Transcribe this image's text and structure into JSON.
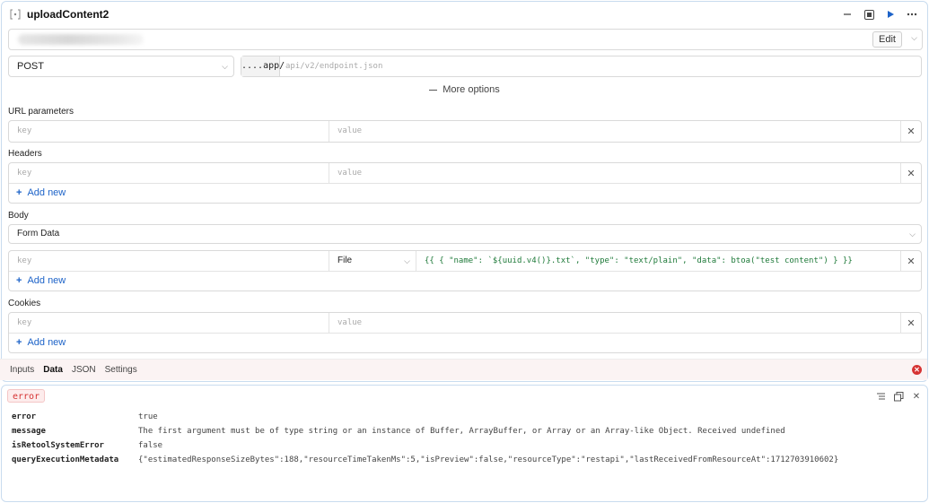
{
  "query": {
    "title": "uploadContent2",
    "edit_label": "Edit",
    "method": "POST",
    "url_prefix": "....app/",
    "url_placeholder": "api/v2/endpoint.json",
    "more_options": "More options"
  },
  "url_params": {
    "label": "URL parameters",
    "key_placeholder": "key",
    "value_placeholder": "value"
  },
  "headers": {
    "label": "Headers",
    "key_placeholder": "key",
    "value_placeholder": "value",
    "add_new": "Add new"
  },
  "body": {
    "label": "Body",
    "type": "Form Data",
    "key_placeholder": "key",
    "field_type": "File",
    "value": "{{ { \"name\": `${uuid.v4()}.txt`, \"type\": \"text/plain\", \"data\": btoa(\"test content\") } }}",
    "add_new": "Add new"
  },
  "cookies": {
    "label": "Cookies",
    "key_placeholder": "key",
    "value_placeholder": "value",
    "add_new": "Add new"
  },
  "tabs": [
    "Inputs",
    "Data",
    "JSON",
    "Settings"
  ],
  "active_tab": "Data",
  "result": {
    "badge": "error",
    "rows": [
      {
        "key": "error",
        "value": "true"
      },
      {
        "key": "message",
        "value": "The first argument must be of type string or an instance of Buffer, ArrayBuffer, or Array or an Array-like Object. Received undefined"
      },
      {
        "key": "isRetoolSystemError",
        "value": "false"
      },
      {
        "key": "queryExecutionMetadata",
        "value": "{\"estimatedResponseSizeBytes\":188,\"resourceTimeTakenMs\":5,\"isPreview\":false,\"resourceType\":\"restapi\",\"lastReceivedFromResourceAt\":1712703910602}"
      }
    ]
  },
  "colors": {
    "accent": "#1d63c8",
    "error": "#d63333",
    "code": "#1f7a3a",
    "panel_border": "#c9dcef"
  }
}
